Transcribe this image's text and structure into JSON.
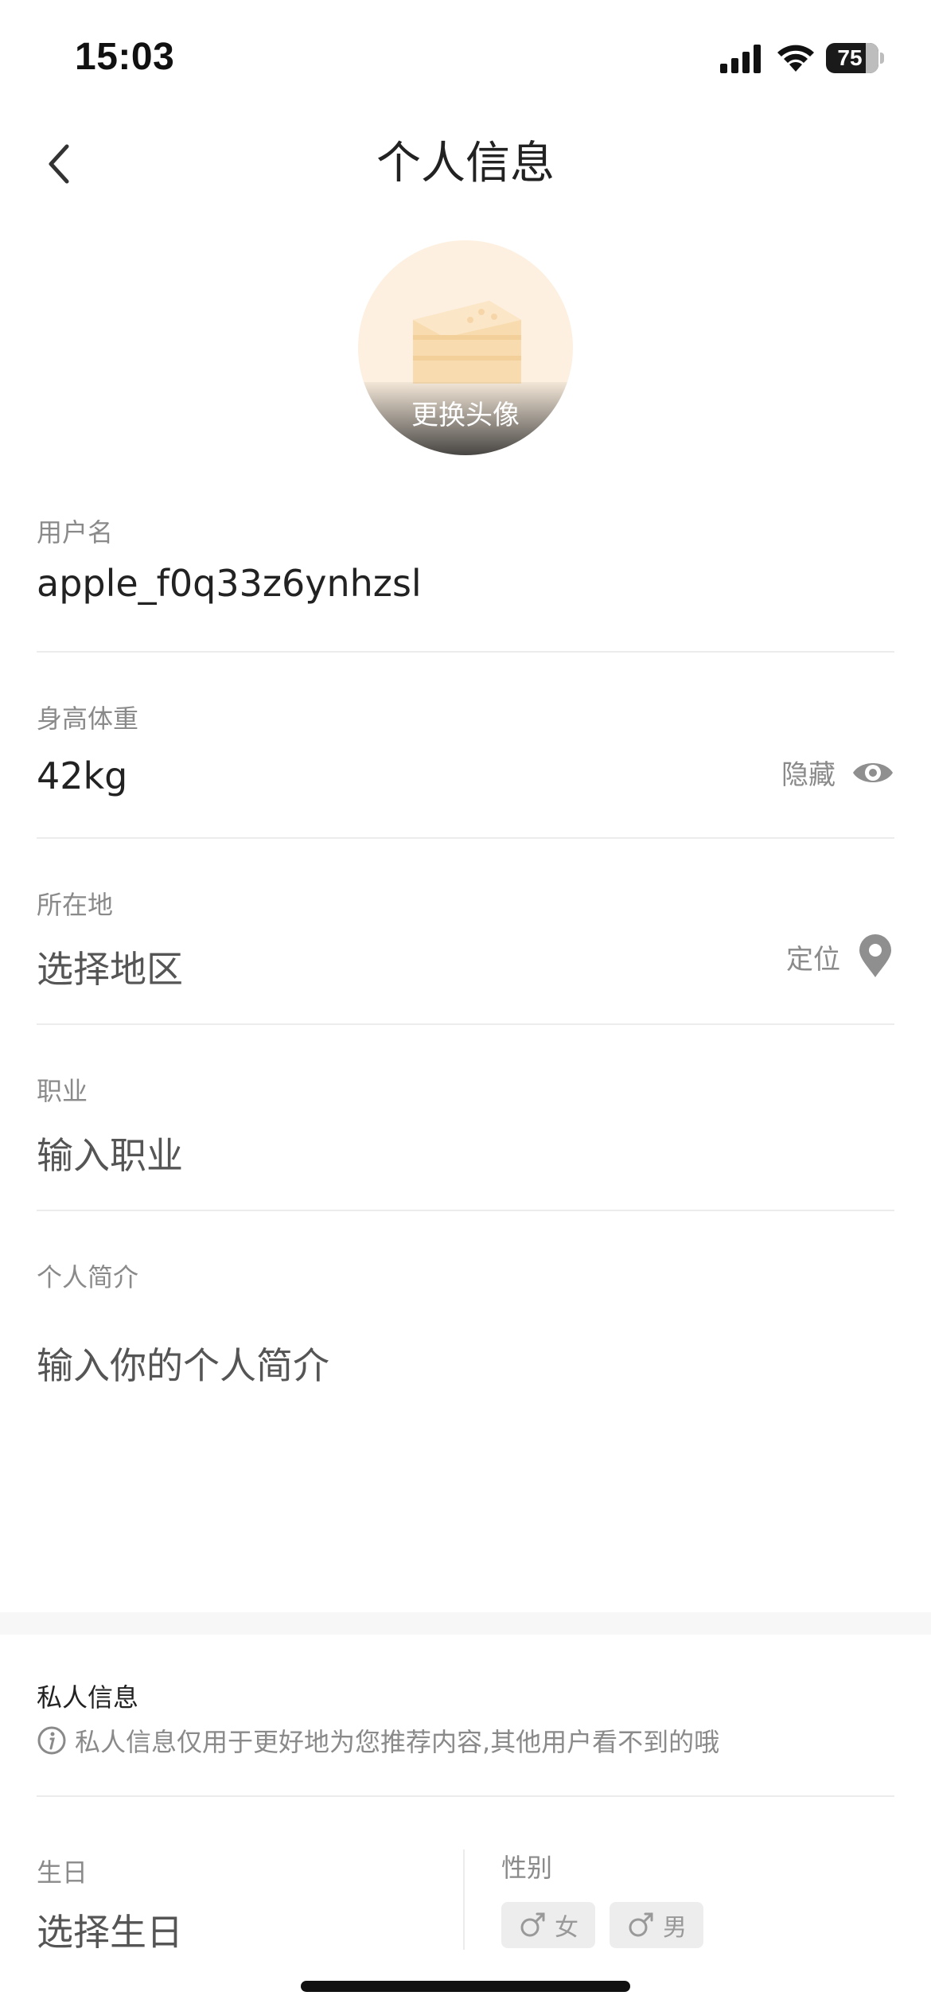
{
  "status_bar": {
    "time": "15:03",
    "battery": "75",
    "icons": [
      "signal-icon",
      "wifi-icon",
      "battery-icon"
    ]
  },
  "nav": {
    "title": "个人信息",
    "back_icon": "chevron-left-icon"
  },
  "avatar": {
    "change_label": "更换头像",
    "image": "cake-icon"
  },
  "fields": {
    "username": {
      "label": "用户名",
      "value": "apple_f0q33z6ynhzsl"
    },
    "height_weight": {
      "label": "身高体重",
      "value": "42kg",
      "action": "隐藏",
      "action_icon": "eye-icon"
    },
    "location": {
      "label": "所在地",
      "placeholder": "选择地区",
      "action": "定位",
      "action_icon": "location-pin-icon"
    },
    "occupation": {
      "label": "职业",
      "placeholder": "输入职业"
    },
    "bio": {
      "label": "个人简介",
      "placeholder": "输入你的个人简介"
    }
  },
  "private": {
    "title": "私人信息",
    "note": "私人信息仅用于更好地为您推荐内容,其他用户看不到的哦",
    "birthday": {
      "label": "生日",
      "placeholder": "选择生日"
    },
    "gender": {
      "label": "性别",
      "options": [
        {
          "label": "女",
          "icon": "gender-symbol-icon"
        },
        {
          "label": "男",
          "icon": "male-symbol-icon"
        }
      ]
    }
  },
  "colors": {
    "text_primary": "#222222",
    "text_secondary": "#8a8a8a",
    "divider": "#ececec",
    "chip_bg": "#ededed",
    "avatar_bg": "#fdf0e0"
  }
}
